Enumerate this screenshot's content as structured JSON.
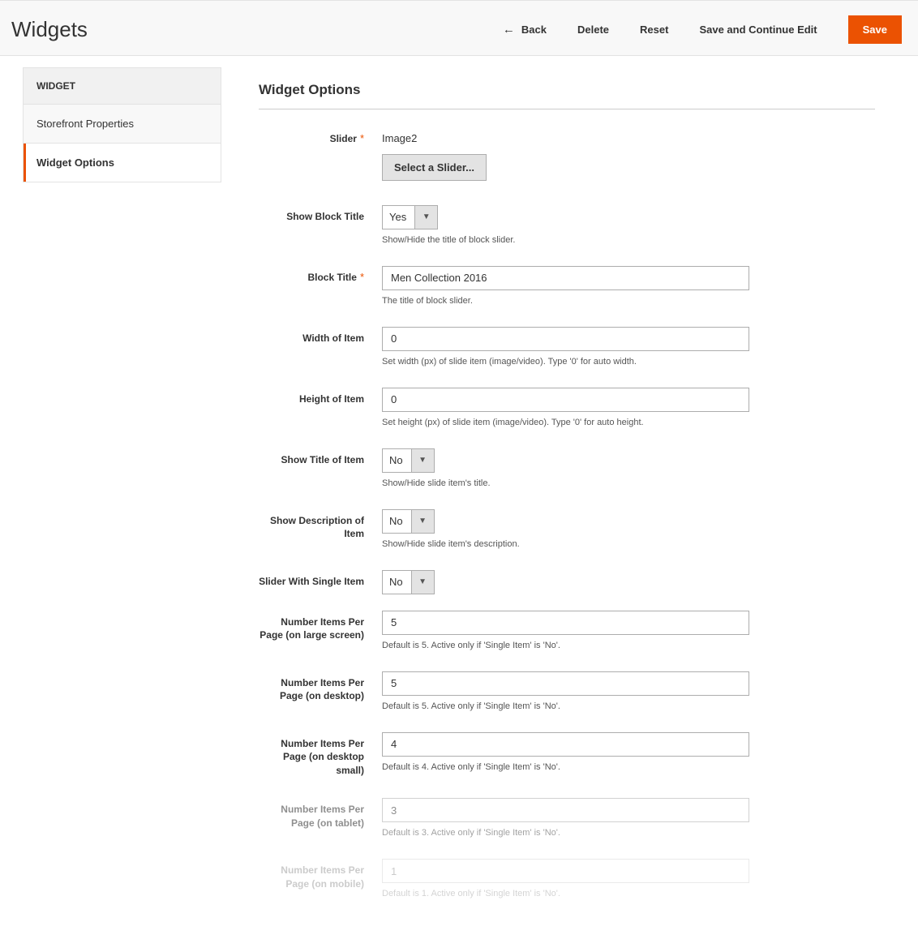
{
  "header": {
    "title": "Widgets",
    "actions": {
      "back": "Back",
      "delete": "Delete",
      "reset": "Reset",
      "save_continue": "Save and Continue Edit",
      "save": "Save"
    }
  },
  "sidebar": {
    "heading": "WIDGET",
    "items": [
      {
        "label": "Storefront Properties",
        "active": false
      },
      {
        "label": "Widget Options",
        "active": true
      }
    ]
  },
  "section_title": "Widget Options",
  "fields": {
    "slider": {
      "label": "Slider",
      "required": true,
      "value": "Image2",
      "button": "Select a Slider..."
    },
    "show_block_title": {
      "label": "Show Block Title",
      "value": "Yes",
      "hint": "Show/Hide the title of block slider."
    },
    "block_title": {
      "label": "Block Title",
      "required": true,
      "value": "Men Collection 2016",
      "hint": "The title of block slider."
    },
    "width_of_item": {
      "label": "Width of Item",
      "value": "0",
      "hint": "Set width (px) of slide item (image/video). Type '0' for auto width."
    },
    "height_of_item": {
      "label": "Height of Item",
      "value": "0",
      "hint": "Set height (px) of slide item (image/video). Type '0' for auto height."
    },
    "show_title_item": {
      "label": "Show Title of Item",
      "value": "No",
      "hint": "Show/Hide slide item's title."
    },
    "show_desc_item": {
      "label": "Show Description of Item",
      "value": "No",
      "hint": "Show/Hide slide item's description."
    },
    "single_item": {
      "label": "Slider With Single Item",
      "value": "No"
    },
    "items_large": {
      "label": "Number Items Per Page (on large screen)",
      "value": "5",
      "hint": "Default is 5. Active only if 'Single Item' is 'No'."
    },
    "items_desktop": {
      "label": "Number Items Per Page (on desktop)",
      "value": "5",
      "hint": "Default is 5. Active only if 'Single Item' is 'No'."
    },
    "items_desktop_small": {
      "label": "Number Items Per Page (on desktop small)",
      "value": "4",
      "hint": "Default is 4. Active only if 'Single Item' is 'No'."
    },
    "items_tablet": {
      "label": "Number Items Per Page (on tablet)",
      "value": "3",
      "hint": "Default is 3. Active only if 'Single Item' is 'No'."
    },
    "items_mobile": {
      "label": "Number Items Per Page (on mobile)",
      "value": "1",
      "hint": "Default is 1. Active only if 'Single Item' is 'No'."
    }
  }
}
